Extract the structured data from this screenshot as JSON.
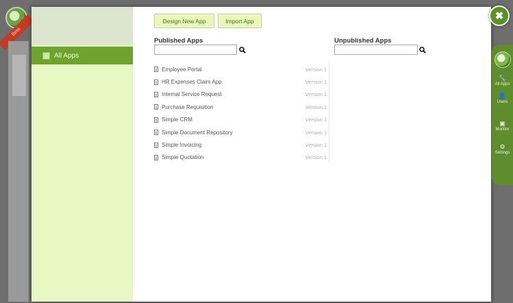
{
  "badge": {
    "beta": "Beta"
  },
  "sidebar": {
    "items": [
      {
        "label": "All Apps"
      }
    ]
  },
  "toolbar": {
    "design_label": "Design New App",
    "import_label": "Import App"
  },
  "published": {
    "title": "Published Apps",
    "search_value": "",
    "apps": [
      {
        "name": "Employee Portal",
        "version": "Version 1"
      },
      {
        "name": "HR Expenses Claim App",
        "version": "Version 1"
      },
      {
        "name": "Internal Service Request",
        "version": "Version 1"
      },
      {
        "name": "Purchase Requisition",
        "version": "Version 1"
      },
      {
        "name": "Simple CRM",
        "version": "Version 1"
      },
      {
        "name": "Simple Document Repository",
        "version": "Version 1"
      },
      {
        "name": "Simple Invoicing",
        "version": "Version 1"
      },
      {
        "name": "Simple Quotation",
        "version": "Version 1"
      }
    ]
  },
  "unpublished": {
    "title": "Unpublished Apps",
    "search_value": ""
  },
  "close": {
    "glyph": "✖"
  },
  "right_nav": {
    "items": [
      {
        "label": "All Apps",
        "icon": "wrench-icon",
        "glyph": "🔧"
      },
      {
        "label": "Users",
        "icon": "user-icon",
        "glyph": "👤"
      },
      {
        "label": "Monitor",
        "icon": "monitor-icon",
        "glyph": "▣"
      },
      {
        "label": "Settings",
        "icon": "gear-icon",
        "glyph": "⚙"
      }
    ]
  },
  "colors": {
    "accent": "#6ea32f",
    "sidebar_bg": "#e7f9c2",
    "button_bg": "#e9f7b9"
  }
}
